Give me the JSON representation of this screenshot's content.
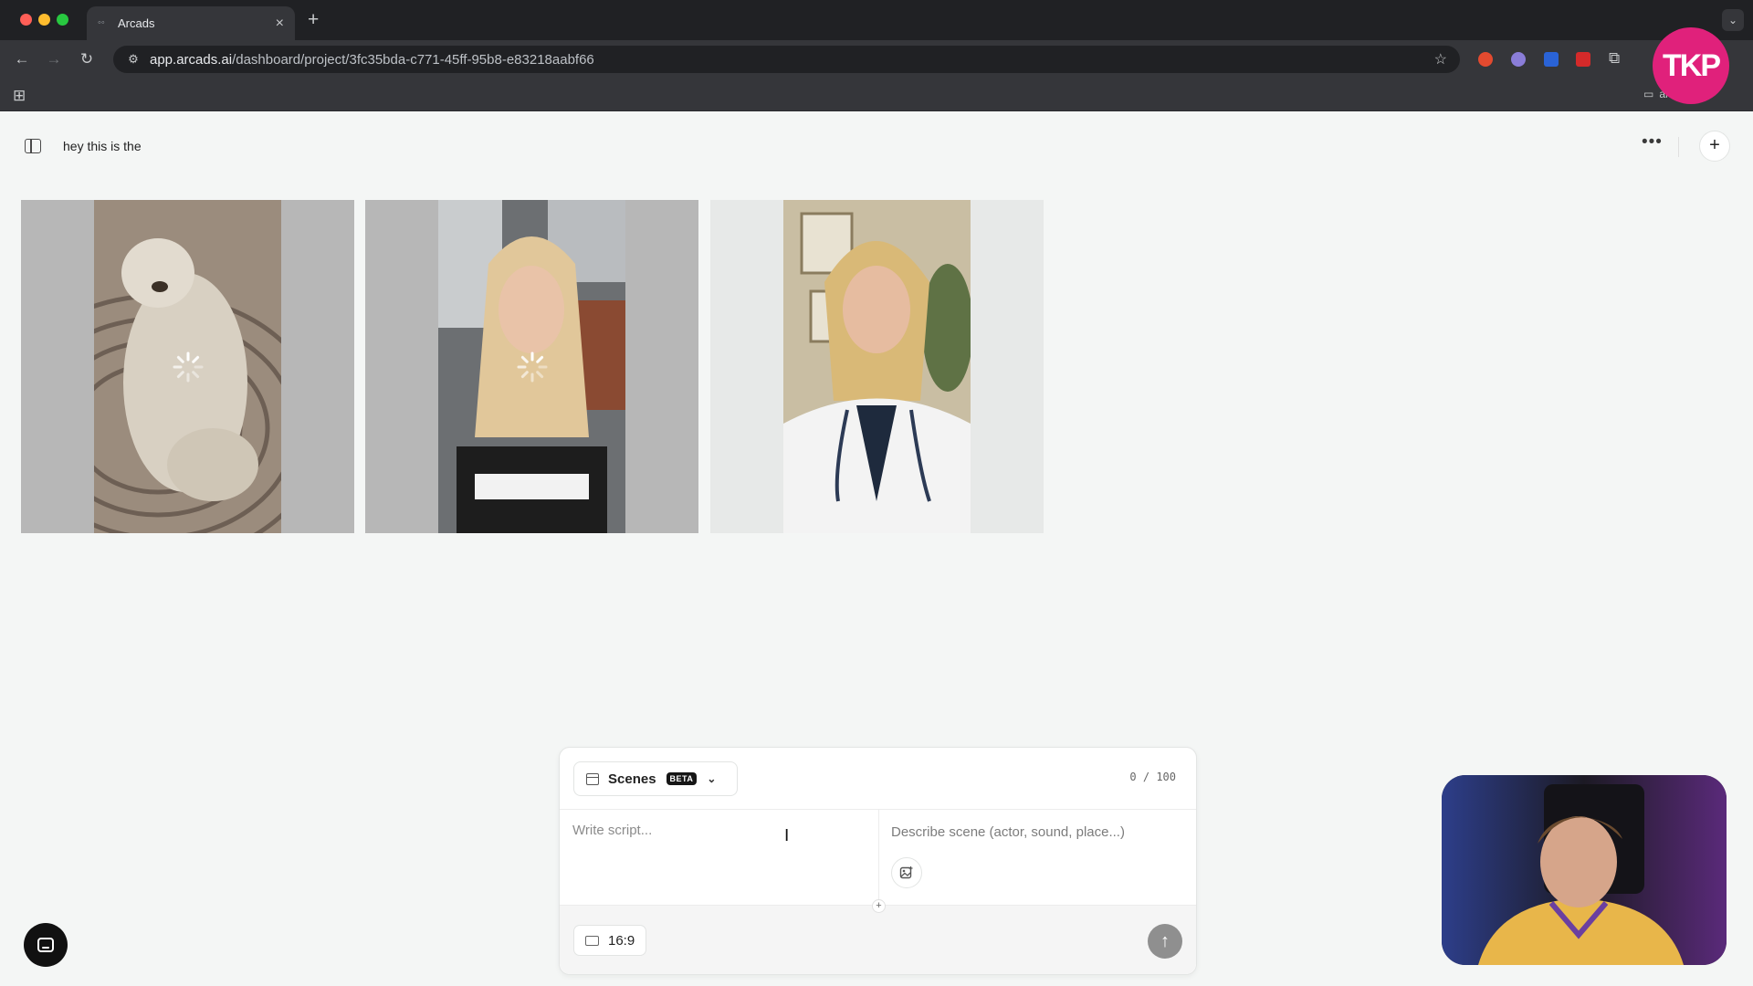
{
  "browser": {
    "tab_title": "Arcads",
    "url_host": "app.arcads.ai",
    "url_path": "/dashboard/project/3fc35bda-c771-45ff-95b8-e83218aabf66",
    "bookmarks_label": "arks",
    "profile_badge": "TKP"
  },
  "project": {
    "title": "hey this is the",
    "more_label": "•••",
    "add_label": "+"
  },
  "cards": [
    {
      "subject": "dog",
      "loading": true
    },
    {
      "subject": "woman in car",
      "loading": true
    },
    {
      "subject": "doctor",
      "loading": false
    }
  ],
  "composer": {
    "mode_label": "Scenes",
    "beta_label": "BETA",
    "char_count": "0 / 100",
    "script_placeholder": "Write script...",
    "scene_placeholder": "Describe scene (actor, sound, place...)",
    "aspect_ratio": "16:9",
    "split_add": "+",
    "send_glyph": "↑"
  },
  "colors": {
    "accent_badge": "#e0217b",
    "send_disabled": "#8f8f8f",
    "page_bg": "#f4f6f5"
  }
}
